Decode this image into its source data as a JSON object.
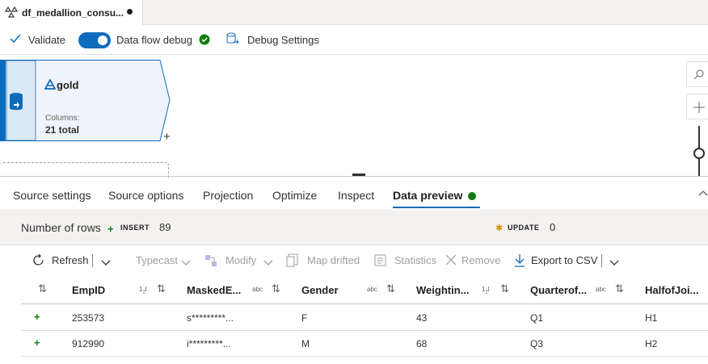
{
  "tab": {
    "title": "df_medallion_consu...",
    "icon": "dataflow-icon"
  },
  "toolbar": {
    "validate": "Validate",
    "debug_label": "Data flow debug",
    "debug_on": true,
    "debug_settings": "Debug Settings"
  },
  "canvas": {
    "node_name": "gold",
    "columns_label": "Columns:",
    "columns_total": "21 total",
    "add": "+"
  },
  "panel_tabs": [
    "Source settings",
    "Source options",
    "Projection",
    "Optimize",
    "Inspect",
    "Data preview"
  ],
  "active_tab": "Data preview",
  "stats": {
    "rows_label": "Number of rows",
    "insert_label": "INSERT",
    "insert_value": "89",
    "update_label": "UPDATE",
    "update_value": "0"
  },
  "actions": {
    "refresh": "Refresh",
    "typecast": "Typecast",
    "modify": "Modify",
    "map_drifted": "Map drifted",
    "statistics": "Statistics",
    "remove": "Remove",
    "export": "Export to CSV"
  },
  "columns": [
    {
      "name": "EmpID",
      "type": "12"
    },
    {
      "name": "MaskedE...",
      "type": "abc"
    },
    {
      "name": "Gender",
      "type": "abc"
    },
    {
      "name": "Weightin...",
      "type": "12"
    },
    {
      "name": "Quarterof...",
      "type": "abc"
    },
    {
      "name": "HalfofJoi...",
      "type": ""
    }
  ],
  "rows": [
    {
      "EmpID": "253573",
      "MaskedE": "s*********...",
      "Gender": "F",
      "Weighting": "43",
      "Quarter": "Q1",
      "Half": "H1"
    },
    {
      "EmpID": "912990",
      "MaskedE": "i*********...",
      "Gender": "M",
      "Weighting": "68",
      "Quarter": "Q3",
      "Half": "H2"
    }
  ],
  "colors": {
    "accent": "#0f6cbd",
    "success": "#107c10",
    "update": "#d29200"
  }
}
